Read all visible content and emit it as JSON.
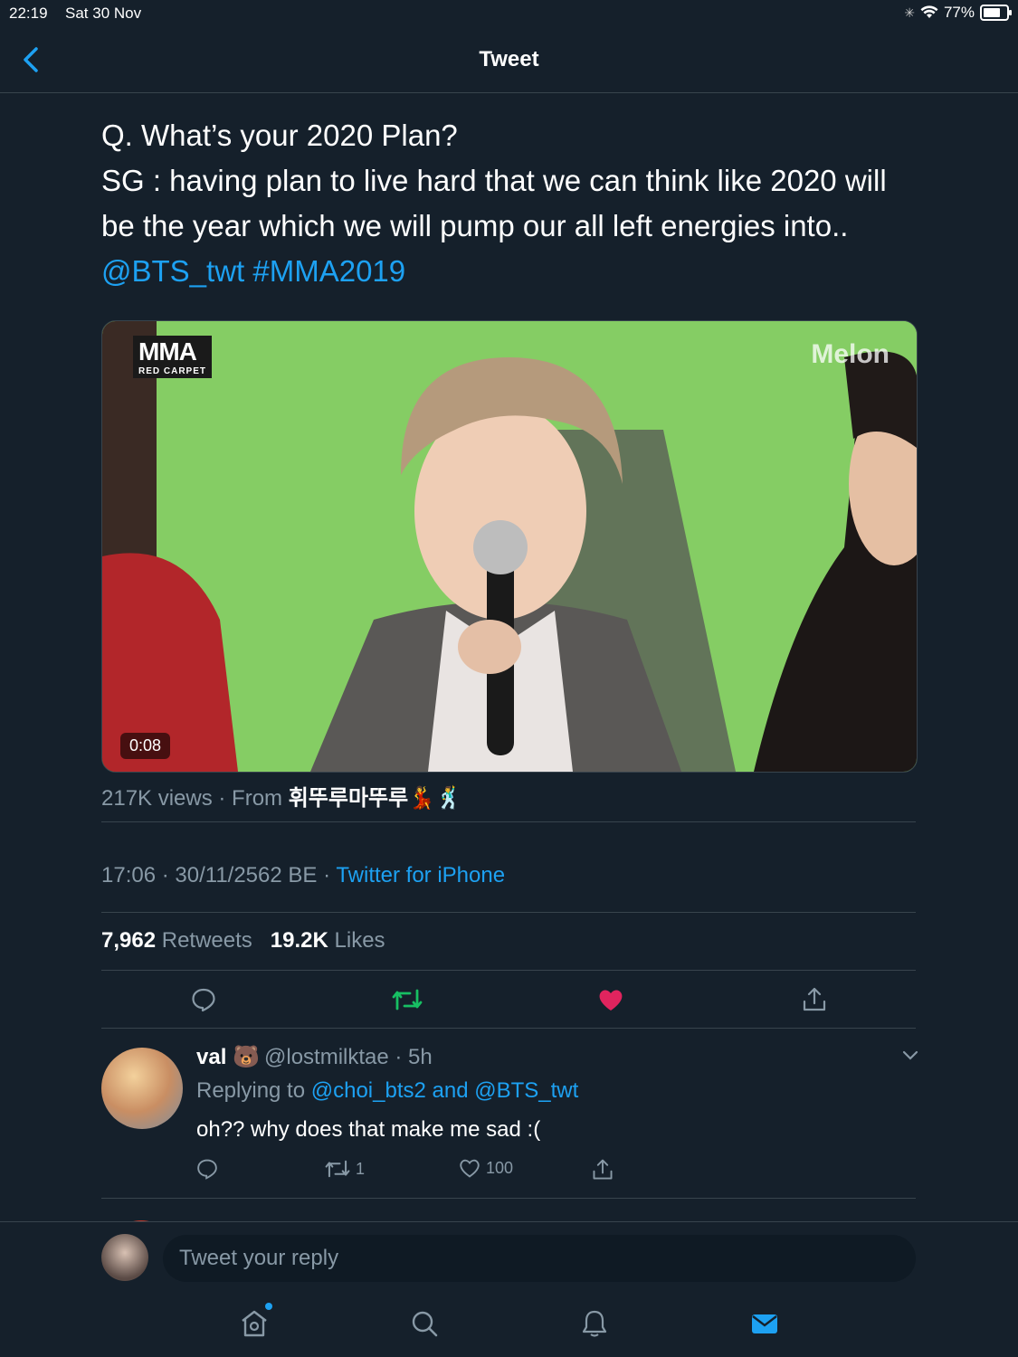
{
  "status_bar": {
    "time": "22:19",
    "date": "Sat 30 Nov",
    "battery": "77%"
  },
  "nav": {
    "title": "Tweet"
  },
  "tweet": {
    "line1": "Q. What’s your 2020 Plan?",
    "line2": "SG : having plan to live hard that we can think like 2020 will",
    "line3": "be the year which we will pump our all left energies into..",
    "mention": "@BTS_twt",
    "hashtag": "#MMA2019",
    "video_duration": "0:08",
    "views": "217K views · From ",
    "source_account": "휘뚜루마뚜루💃🕺",
    "timestamp": "17:06 · 30/11/2562 BE · ",
    "client": "Twitter for iPhone",
    "retweets_count": "7,962",
    "retweets_label": " Retweets",
    "likes_count": "19.2K",
    "likes_label": " Likes",
    "media_logo_text": "MMA",
    "media_logo_sub": "RED CARPET",
    "media_watermark": "Melon"
  },
  "reply": {
    "name": "val 🐻",
    "handle": "@lostmilktae · 5h",
    "replying_prefix": "Replying to ",
    "replying_to": "@choi_bts2 and @BTS_twt",
    "text": "oh?? why does that make me sad :(",
    "retweet_count": "1",
    "like_count": "100"
  },
  "compose": {
    "placeholder": "Tweet your reply"
  },
  "colors": {
    "background": "#15202b",
    "accent": "#1da1f2",
    "retweet_active": "#17bf63",
    "like_active": "#e0245e",
    "muted": "#8899a6"
  },
  "icons": [
    "chevron-left-icon",
    "reply-icon",
    "retweet-icon",
    "heart-icon",
    "share-icon",
    "home-icon",
    "search-icon",
    "bell-icon",
    "mail-icon"
  ]
}
